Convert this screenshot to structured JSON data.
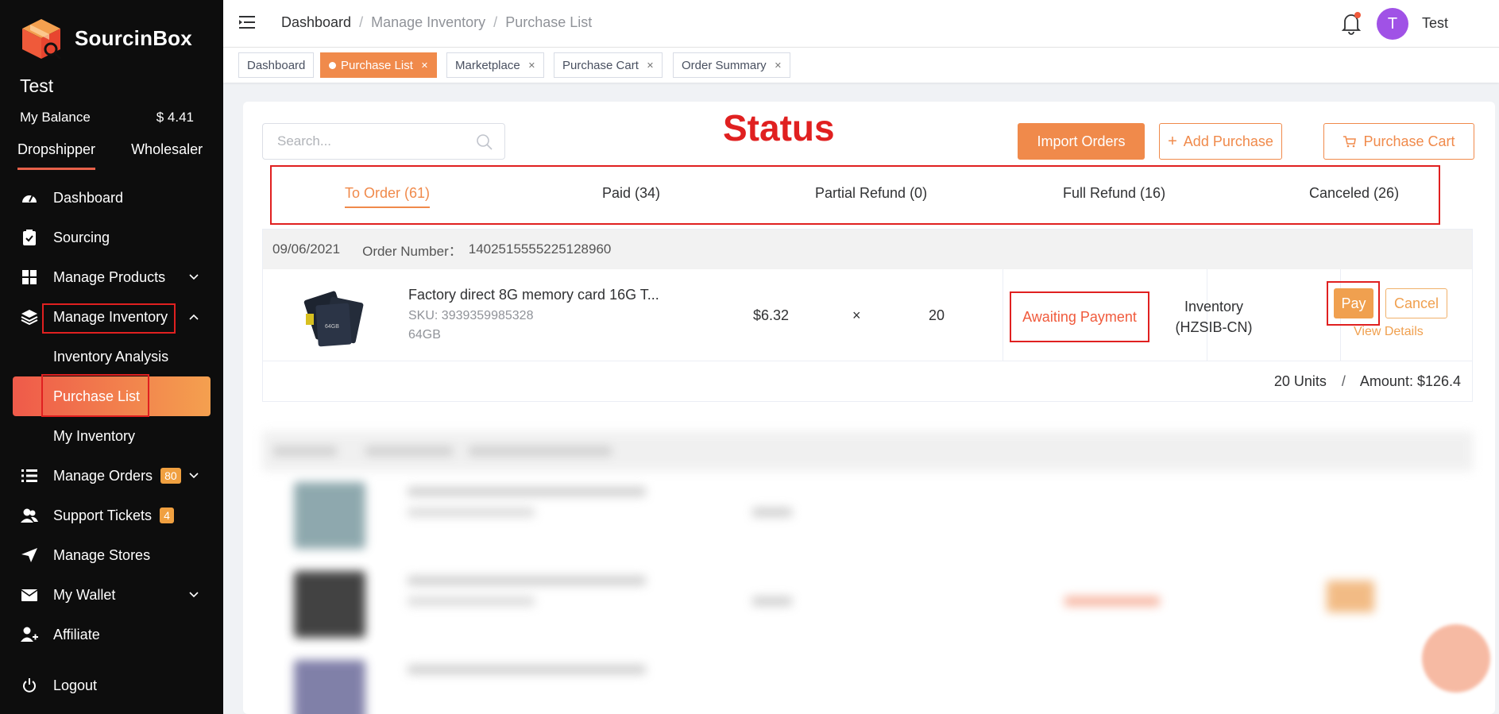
{
  "brand": {
    "name": "SourcinBox",
    "accent": "#f08a4b"
  },
  "sidebar": {
    "user_name": "Test",
    "balance_label": "My Balance",
    "balance_value": "$ 4.41",
    "role_tabs": [
      "Dropshipper",
      "Wholesaler"
    ],
    "items": [
      {
        "label": "Dashboard",
        "icon": "dashboard-icon"
      },
      {
        "label": "Sourcing",
        "icon": "clipboard-icon"
      },
      {
        "label": "Manage Products",
        "icon": "grid-icon"
      },
      {
        "label": "Manage Inventory",
        "icon": "layers-icon"
      },
      {
        "label": "Manage Orders",
        "icon": "list-icon",
        "count": "80"
      },
      {
        "label": "Support Tickets",
        "icon": "users-icon",
        "count": "4"
      },
      {
        "label": "Manage Stores",
        "icon": "send-icon"
      },
      {
        "label": "My Wallet",
        "icon": "mail-icon"
      },
      {
        "label": "Affiliate",
        "icon": "user-plus-icon"
      }
    ],
    "inventory_sub": [
      "Inventory Analysis",
      "Purchase List",
      "My Inventory"
    ],
    "logout": "Logout"
  },
  "topbar": {
    "breadcrumb": [
      "Dashboard",
      "Manage Inventory",
      "Purchase List"
    ],
    "avatar_letter": "T",
    "user": "Test"
  },
  "tags": [
    "Dashboard",
    "Purchase List",
    "Marketplace",
    "Purchase Cart",
    "Order Summary"
  ],
  "main": {
    "search_placeholder": "Search...",
    "annotation": "Status",
    "buttons": {
      "import": "Import Orders",
      "add": "Add Purchase",
      "cart": "Purchase Cart"
    },
    "status_tabs": [
      "To Order (61)",
      "Paid (34)",
      "Partial Refund (0)",
      "Full Refund (16)",
      "Canceled (26)"
    ],
    "order": {
      "date": "09/06/2021",
      "number_label": "Order Number：",
      "number": "1402515555225128960",
      "title": "Factory direct 8G memory card 16G T...",
      "sku": "SKU: 3939359985328",
      "variant": "64GB",
      "price": "$6.32",
      "times": "×",
      "qty": "20",
      "status": "Awaiting Payment",
      "warehouse_line1": "Inventory",
      "warehouse_line2": "(HZSIB-CN)",
      "pay": "Pay",
      "cancel": "Cancel",
      "view": "View Details",
      "units": "20 Units",
      "slash": "/",
      "amount": "Amount: $126.4"
    }
  }
}
